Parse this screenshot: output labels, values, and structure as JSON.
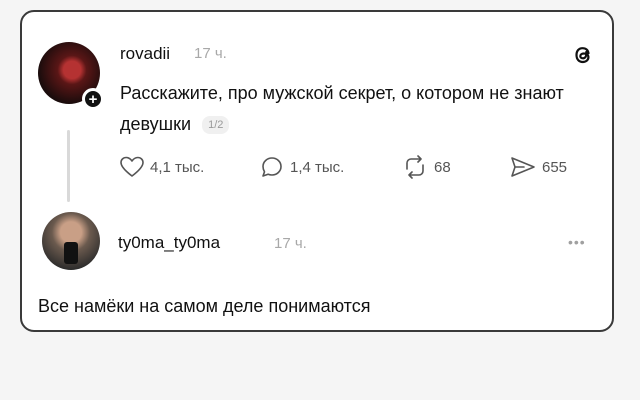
{
  "post": {
    "username": "rovadii",
    "time": "17 ч.",
    "text": "Расскажите, про мужской секрет, о котором не знают девушки",
    "page_counter": "1/2",
    "actions": {
      "likes": "4,1 тыс.",
      "comments": "1,4 тыс.",
      "reposts": "68",
      "shares": "655"
    }
  },
  "reply": {
    "username": "ty0ma_ty0ma",
    "time": "17 ч.",
    "text": "Все намёки на самом деле понимаются"
  },
  "icons": {
    "like": "heart-icon",
    "comment": "speech-bubble-icon",
    "repost": "repost-icon",
    "share": "paper-plane-icon",
    "brand": "threads-logo-icon",
    "more": "more-dots-icon",
    "follow": "plus-icon"
  },
  "colors": {
    "text": "#111111",
    "muted": "#a8a8a8",
    "card_border": "#3a3a3a",
    "background": "#f2f2f2"
  }
}
